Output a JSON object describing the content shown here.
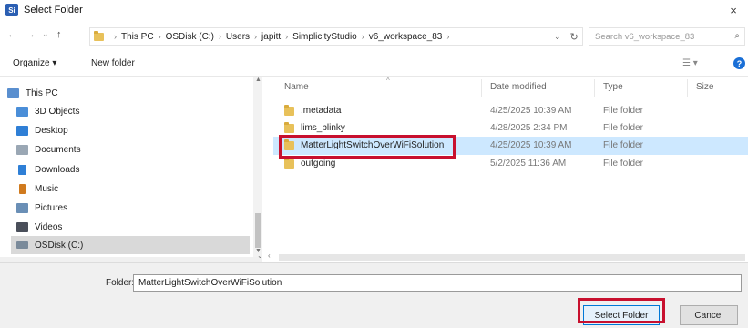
{
  "window": {
    "app_icon_label": "Si",
    "title": "Select Folder",
    "close_glyph": "×"
  },
  "nav": {
    "back_glyph": "←",
    "forward_glyph": "→",
    "history_glyph": "⌄",
    "up_glyph": "↑",
    "breadcrumbs": [
      "This PC",
      "OSDisk (C:)",
      "Users",
      "japitt",
      "SimplicityStudio",
      "v6_workspace_83"
    ],
    "breadcrumb_separator": "›",
    "dropdown_glyph": "⌄",
    "refresh_glyph": "↻",
    "search_placeholder": "Search v6_workspace_83",
    "search_icon_glyph": "⌕"
  },
  "toolbar": {
    "organize_label": "Organize ▾",
    "new_folder_label": "New folder",
    "view_glyph": "☰ ▾",
    "help_glyph": "?"
  },
  "sidebar": {
    "items": [
      {
        "label": "This PC",
        "icon": "pc-icon",
        "color": "#5a8fcf"
      },
      {
        "label": "3D Objects",
        "icon": "objects-3d-icon",
        "color": "#4a8ed8"
      },
      {
        "label": "Desktop",
        "icon": "desktop-icon",
        "color": "#2f7fd6"
      },
      {
        "label": "Documents",
        "icon": "documents-icon",
        "color": "#9aa7b4"
      },
      {
        "label": "Downloads",
        "icon": "downloads-icon",
        "color": "#2f7fd6"
      },
      {
        "label": "Music",
        "icon": "music-icon",
        "color": "#d07a1e"
      },
      {
        "label": "Pictures",
        "icon": "pictures-icon",
        "color": "#6a8fb6"
      },
      {
        "label": "Videos",
        "icon": "videos-icon",
        "color": "#4a4f5a"
      },
      {
        "label": "OSDisk (C:)",
        "icon": "drive-icon",
        "color": "#7a8a9a",
        "selected": true
      }
    ]
  },
  "files": {
    "columns": {
      "name": "Name",
      "date": "Date modified",
      "type": "Type",
      "size": "Size"
    },
    "sort_glyph": "^",
    "rows": [
      {
        "name": ".metadata",
        "date": "4/25/2025 10:39 AM",
        "type": "File folder"
      },
      {
        "name": "lims_blinky",
        "date": "4/28/2025 2:34 PM",
        "type": "File folder"
      },
      {
        "name": "MatterLightSwitchOverWiFiSolution",
        "date": "4/25/2025 10:39 AM",
        "type": "File folder",
        "selected": true
      },
      {
        "name": "outgoing",
        "date": "5/2/2025 11:36 AM",
        "type": "File folder"
      }
    ]
  },
  "footer": {
    "folder_label": "Folder:",
    "folder_value": "MatterLightSwitchOverWiFiSolution",
    "select_button": "Select Folder",
    "cancel_button": "Cancel"
  },
  "colors": {
    "highlight_red": "#c8102e",
    "selection_blue": "#cde8ff",
    "folder_yellow": "#e8c15a",
    "accent_blue": "#0078d7"
  }
}
